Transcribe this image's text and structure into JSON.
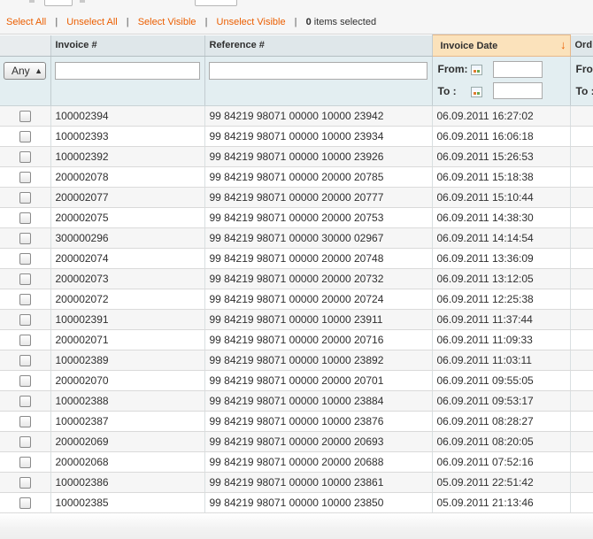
{
  "massaction": {
    "select_all": "Select All",
    "unselect_all": "Unselect All",
    "select_visible": "Select Visible",
    "unselect_visible": "Unselect Visible",
    "separator": "|",
    "selected_count": "0",
    "selected_suffix": "items selected"
  },
  "columns": {
    "invoice": "Invoice #",
    "reference": "Reference #",
    "invoice_date": "Invoice Date",
    "order": "Ord",
    "sort_arrow": "↓"
  },
  "filter": {
    "any": "Any",
    "from": "From:",
    "to": "To :",
    "order_from": "Fro",
    "order_to": "To :"
  },
  "rows": [
    {
      "invoice": "100002394",
      "reference": "99 84219 98071 00000 10000 23942",
      "date": "06.09.2011 16:27:02"
    },
    {
      "invoice": "100002393",
      "reference": "99 84219 98071 00000 10000 23934",
      "date": "06.09.2011 16:06:18"
    },
    {
      "invoice": "100002392",
      "reference": "99 84219 98071 00000 10000 23926",
      "date": "06.09.2011 15:26:53"
    },
    {
      "invoice": "200002078",
      "reference": "99 84219 98071 00000 20000 20785",
      "date": "06.09.2011 15:18:38"
    },
    {
      "invoice": "200002077",
      "reference": "99 84219 98071 00000 20000 20777",
      "date": "06.09.2011 15:10:44"
    },
    {
      "invoice": "200002075",
      "reference": "99 84219 98071 00000 20000 20753",
      "date": "06.09.2011 14:38:30"
    },
    {
      "invoice": "300000296",
      "reference": "99 84219 98071 00000 30000 02967",
      "date": "06.09.2011 14:14:54"
    },
    {
      "invoice": "200002074",
      "reference": "99 84219 98071 00000 20000 20748",
      "date": "06.09.2011 13:36:09"
    },
    {
      "invoice": "200002073",
      "reference": "99 84219 98071 00000 20000 20732",
      "date": "06.09.2011 13:12:05"
    },
    {
      "invoice": "200002072",
      "reference": "99 84219 98071 00000 20000 20724",
      "date": "06.09.2011 12:25:38"
    },
    {
      "invoice": "100002391",
      "reference": "99 84219 98071 00000 10000 23911",
      "date": "06.09.2011 11:37:44"
    },
    {
      "invoice": "200002071",
      "reference": "99 84219 98071 00000 20000 20716",
      "date": "06.09.2011 11:09:33"
    },
    {
      "invoice": "100002389",
      "reference": "99 84219 98071 00000 10000 23892",
      "date": "06.09.2011 11:03:11"
    },
    {
      "invoice": "200002070",
      "reference": "99 84219 98071 00000 20000 20701",
      "date": "06.09.2011 09:55:05"
    },
    {
      "invoice": "100002388",
      "reference": "99 84219 98071 00000 10000 23884",
      "date": "06.09.2011 09:53:17"
    },
    {
      "invoice": "100002387",
      "reference": "99 84219 98071 00000 10000 23876",
      "date": "06.09.2011 08:28:27"
    },
    {
      "invoice": "200002069",
      "reference": "99 84219 98071 00000 20000 20693",
      "date": "06.09.2011 08:20:05"
    },
    {
      "invoice": "200002068",
      "reference": "99 84219 98071 00000 20000 20688",
      "date": "06.09.2011 07:52:16"
    },
    {
      "invoice": "100002386",
      "reference": "99 84219 98071 00000 10000 23861",
      "date": "05.09.2011 22:51:42"
    },
    {
      "invoice": "100002385",
      "reference": "99 84219 98071 00000 10000 23850",
      "date": "05.09.2011 21:13:46"
    }
  ],
  "colors": {
    "link": "#eb5e00",
    "header": "#dfe7ea",
    "sorted_header": "#fbe2bb",
    "filter_row": "#e3eef1"
  },
  "icons": {
    "calendar": "calendar-icon",
    "sort": "sort-desc-arrow-icon",
    "select_arrows": "updown-arrows-icon"
  }
}
